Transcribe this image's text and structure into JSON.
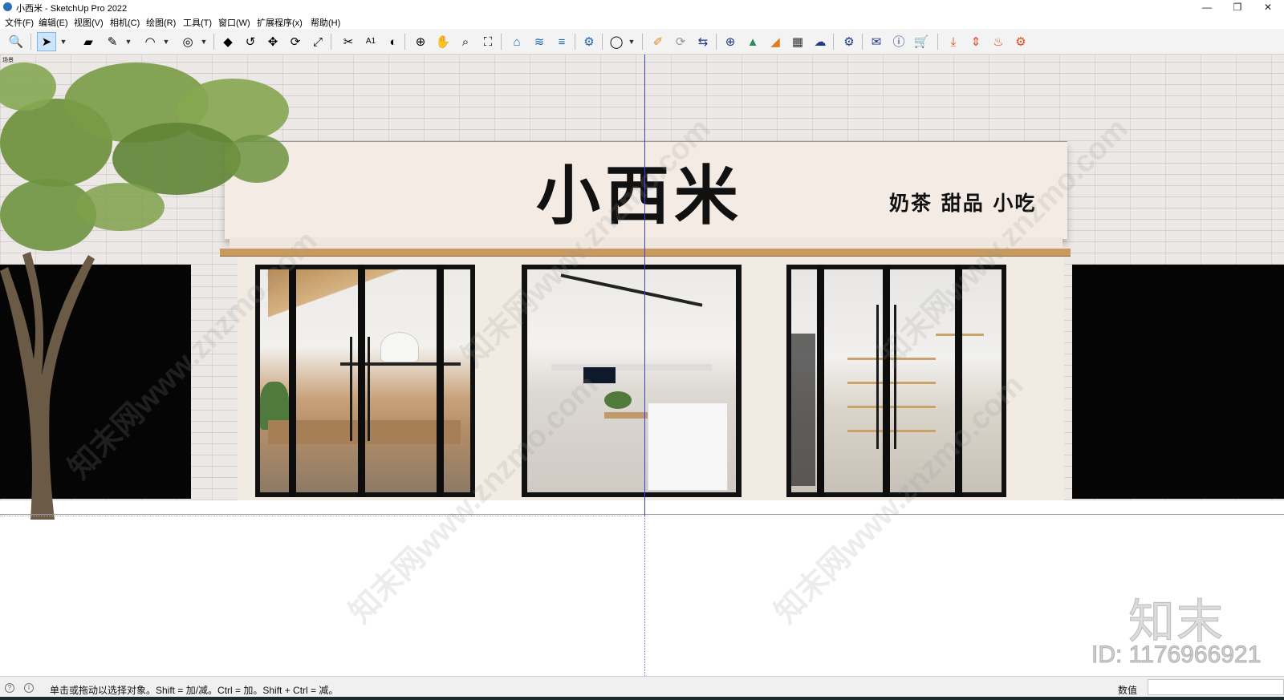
{
  "window": {
    "title": "小西米 - SketchUp Pro 2022",
    "minimize": "—",
    "restore": "❐",
    "close": "✕"
  },
  "menu": [
    "文件(F)",
    "编辑(E)",
    "视图(V)",
    "相机(C)",
    "绘图(R)",
    "工具(T)",
    "窗口(W)",
    "扩展程序(x)",
    "帮助(H)"
  ],
  "toolbar": {
    "tools": [
      {
        "name": "zoom-icon",
        "glyph": "🔍"
      },
      {
        "name": "select-icon",
        "glyph": "➤",
        "active": true
      },
      {
        "name": "eraser-icon",
        "glyph": "▰"
      },
      {
        "name": "pencil-icon",
        "glyph": "✎"
      },
      {
        "name": "arc-icon",
        "glyph": "◠"
      },
      {
        "name": "tape-measure-icon",
        "glyph": "◎"
      },
      {
        "name": "push-pull-icon",
        "glyph": "◆"
      },
      {
        "name": "follow-me-icon",
        "glyph": "↺"
      },
      {
        "name": "move-icon",
        "glyph": "✥"
      },
      {
        "name": "rotate-icon",
        "glyph": "⟳"
      },
      {
        "name": "scale-icon",
        "glyph": "⤢"
      },
      {
        "name": "text-icon",
        "glyph": "A1"
      },
      {
        "name": "paint-bucket-icon",
        "glyph": "◐"
      },
      {
        "name": "orbit-icon",
        "glyph": "⊕"
      },
      {
        "name": "pan-icon",
        "glyph": "✋"
      },
      {
        "name": "zoom-window-icon",
        "glyph": "⌕"
      },
      {
        "name": "zoom-extents-icon",
        "glyph": "⛶"
      }
    ],
    "warehouse": [
      {
        "name": "warehouse-icon",
        "glyph": "⌂"
      },
      {
        "name": "extension-warehouse-icon",
        "glyph": "≋"
      },
      {
        "name": "layout-icon",
        "glyph": "≡"
      },
      {
        "name": "extension-manager-icon",
        "glyph": "⚙"
      }
    ],
    "plugins": [
      {
        "name": "plugin-edit-icon",
        "glyph": "✐",
        "color": "#e08a1e"
      },
      {
        "name": "refresh-icon",
        "glyph": "⟳",
        "color": "#999999"
      },
      {
        "name": "plugin-arrows-icon",
        "glyph": "⇆",
        "color": "#1e3a8a"
      },
      {
        "name": "add-circle-icon",
        "glyph": "⊕",
        "color": "#1e3a8a"
      },
      {
        "name": "tree-icon",
        "glyph": "▲",
        "color": "#2e8b57"
      },
      {
        "name": "layers-plugin-icon",
        "glyph": "◢",
        "color": "#e07b1e"
      },
      {
        "name": "checker-icon",
        "glyph": "▦",
        "color": "#333333"
      },
      {
        "name": "cloud-upload-icon",
        "glyph": "☁",
        "color": "#1e3a8a"
      },
      {
        "name": "settings-icon",
        "glyph": "⚙",
        "color": "#1e3a8a"
      },
      {
        "name": "mail-icon",
        "glyph": "✉",
        "color": "#1e3a8a"
      },
      {
        "name": "info-icon",
        "glyph": "ⓘ",
        "color": "#1e3a8a"
      },
      {
        "name": "cart-icon",
        "glyph": "🛒",
        "color": "#1e3a8a"
      },
      {
        "name": "download-plugin-icon",
        "glyph": "⤓",
        "color": "#e04a1e"
      },
      {
        "name": "flip-plugin-icon",
        "glyph": "⇕",
        "color": "#e04a1e"
      },
      {
        "name": "fire-plugin-icon",
        "glyph": "♨",
        "color": "#e04a1e"
      },
      {
        "name": "gear-plugin-icon",
        "glyph": "⚙",
        "color": "#e04a1e"
      }
    ]
  },
  "scene": {
    "scene_tab": "场景",
    "store_name": "小西米",
    "tagline": "奶茶 甜品 小吃"
  },
  "watermarks": {
    "diagonal": "知末网www.znzmo.com",
    "logo": "知末",
    "id": "ID: 1176966921"
  },
  "statusbar": {
    "message": "单击或拖动以选择对象。Shift = 加/减。Ctrl = 加。Shift + Ctrl = 减。",
    "measurements_label": "数值",
    "measurements_value": ""
  }
}
